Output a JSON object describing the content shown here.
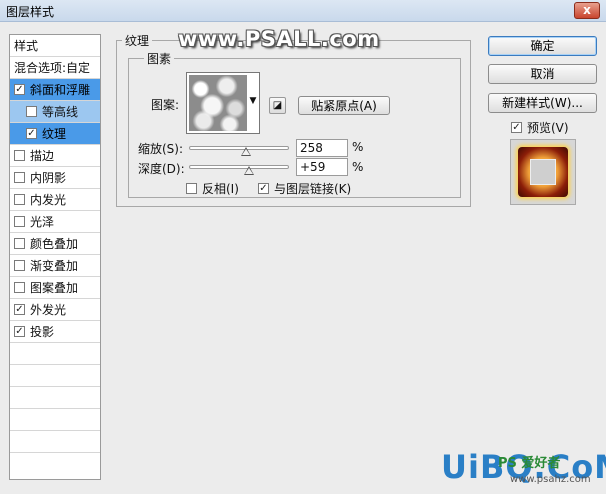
{
  "window": {
    "title": "图层样式",
    "close": "x"
  },
  "watermark": "www.PSALL.com",
  "left_panel": {
    "header": "样式",
    "blend": "混合选项:自定",
    "items": [
      {
        "label": "斜面和浮雕",
        "checked": true,
        "state": "selected"
      },
      {
        "label": "等高线",
        "checked": false,
        "state": "sub-light"
      },
      {
        "label": "纹理",
        "checked": true,
        "state": "sub-selected"
      },
      {
        "label": "描边",
        "checked": false
      },
      {
        "label": "内阴影",
        "checked": false
      },
      {
        "label": "内发光",
        "checked": false
      },
      {
        "label": "光泽",
        "checked": false
      },
      {
        "label": "颜色叠加",
        "checked": false
      },
      {
        "label": "渐变叠加",
        "checked": false
      },
      {
        "label": "图案叠加",
        "checked": false
      },
      {
        "label": "外发光",
        "checked": true
      },
      {
        "label": "投影",
        "checked": true
      }
    ]
  },
  "texture": {
    "group_label": "纹理",
    "elements_label": "图素",
    "pattern_label": "图案:",
    "snap_origin_button": "贴紧原点(A)",
    "scale_label": "缩放(S):",
    "scale_value": "258",
    "scale_unit": "%",
    "scale_fraction": 0.57,
    "depth_label": "深度(D):",
    "depth_value": "+59",
    "depth_unit": "%",
    "depth_fraction": 0.6,
    "invert_label": "反相(I)",
    "invert_checked": false,
    "link_label": "与图层链接(K)",
    "link_checked": true
  },
  "right_panel": {
    "ok": "确定",
    "cancel": "取消",
    "new_style": "新建样式(W)...",
    "preview_label": "预览(V)",
    "preview_checked": true
  },
  "logo": {
    "main": "UiBQ.CoM",
    "sub": "PS 爱好者",
    "url": "www.psahz.com"
  },
  "colors": {
    "selection": "#4a9ae8",
    "selection_light": "#9cc7f0",
    "logo": "#2a7fc6"
  }
}
